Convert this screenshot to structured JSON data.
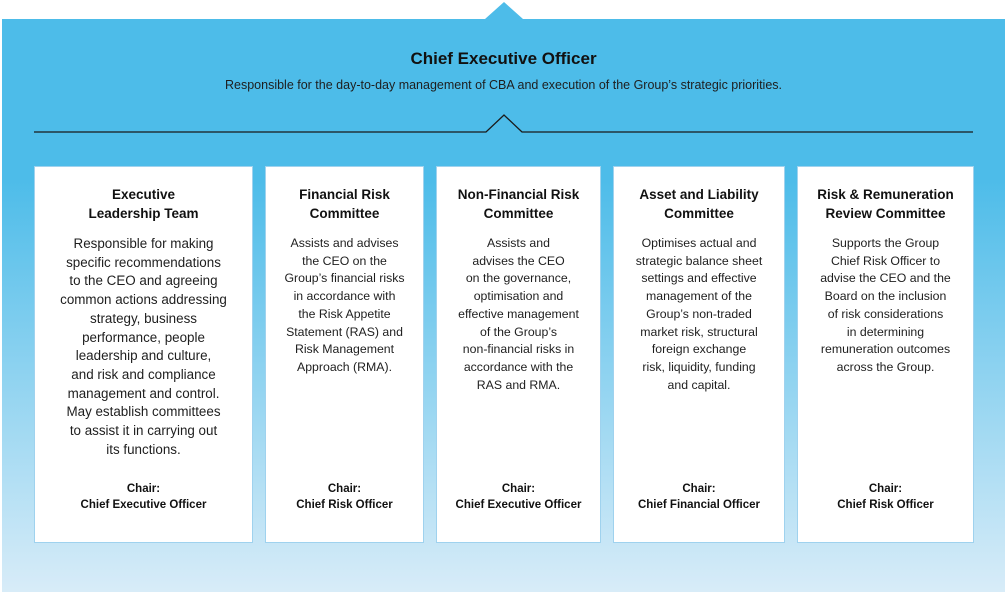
{
  "header": {
    "title": "Chief Executive Officer",
    "subtitle": "Responsible for the day-to-day management of CBA and execution of the Group’s strategic priorities."
  },
  "colors": {
    "panel_top": "#4dbce9",
    "panel_bottom": "#d8ecf8",
    "divider": "#1a1a1a",
    "card_border": "#9fd2ee"
  },
  "committees": [
    {
      "title": "Executive\nLeadership Team",
      "description": "Responsible for making\nspecific recommendations\nto the CEO and agreeing\ncommon actions addressing\nstrategy, business\nperformance, people\nleadership and culture,\nand risk and compliance\nmanagement and control.\nMay establish committees\nto assist it in carrying out\nits functions.",
      "chair_label": "Chair:",
      "chair": "Chief Executive Officer"
    },
    {
      "title": "Financial Risk\nCommittee",
      "description": "Assists and advises\nthe CEO on the\nGroup’s financial risks\nin accordance with\nthe Risk Appetite\nStatement (RAS) and\nRisk Management\nApproach (RMA).",
      "chair_label": "Chair:",
      "chair": "Chief Risk Officer"
    },
    {
      "title": "Non-Financial Risk\nCommittee",
      "description": "Assists and\nadvises the CEO\non the governance,\noptimisation and\neffective management\nof the Group’s\nnon-financial risks in\naccordance with the\nRAS and RMA.",
      "chair_label": "Chair:",
      "chair": "Chief Executive Officer"
    },
    {
      "title": "Asset and Liability\nCommittee",
      "description": "Optimises actual and\nstrategic balance sheet\nsettings and effective\nmanagement of the\nGroup’s non-traded\nmarket risk, structural\nforeign exchange\nrisk, liquidity, funding\nand capital.",
      "chair_label": "Chair:",
      "chair": "Chief Financial Officer"
    },
    {
      "title": "Risk & Remuneration\nReview Committee",
      "description": "Supports the Group\nChief Risk Officer to\nadvise the CEO and the\nBoard on the inclusion\nof risk considerations\nin determining\nremuneration outcomes\nacross the Group.",
      "chair_label": "Chair:",
      "chair": "Chief Risk Officer"
    }
  ]
}
